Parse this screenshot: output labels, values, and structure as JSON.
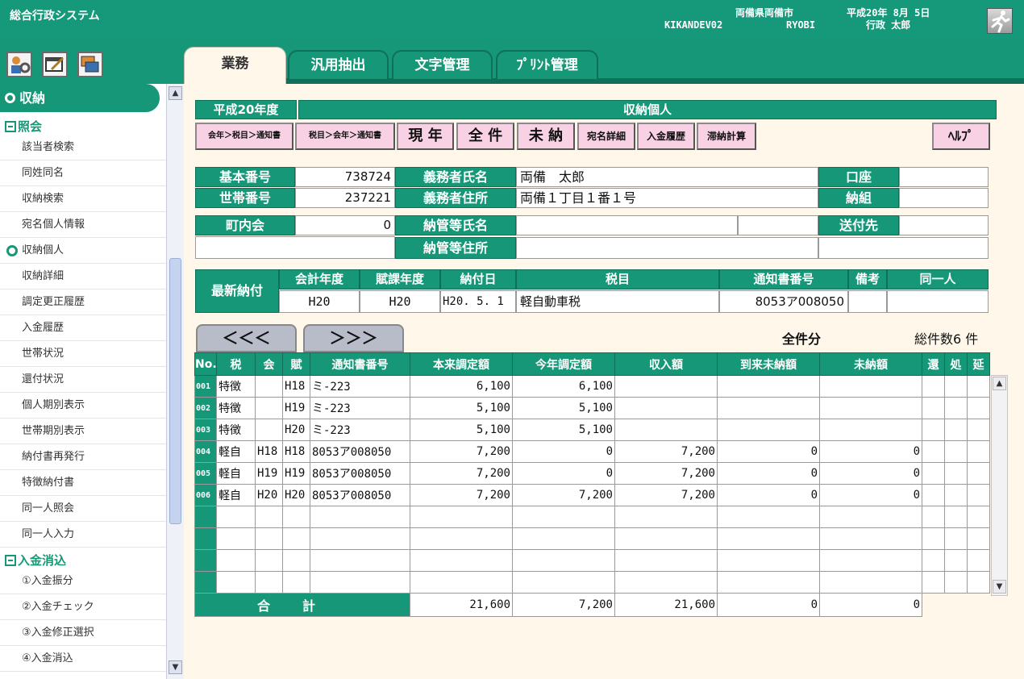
{
  "header": {
    "app_title": "総合行政システム",
    "line1": "両備県両備市  平成20年 8月 5日",
    "line2": "KIKANDEV02       RYOBI       行政 太郎",
    "org": "両備県両備市",
    "date": "平成20年 8月 5日",
    "terminal": "KIKANDEV02",
    "user_id": "RYOBI",
    "user_name": "行政 太郎"
  },
  "tabs": [
    {
      "label": "業務",
      "active": true
    },
    {
      "label": "汎用抽出",
      "active": false
    },
    {
      "label": "文字管理",
      "active": false
    },
    {
      "label": "ﾌﾟﾘﾝﾄ管理",
      "active": false
    }
  ],
  "sidebar": {
    "section": "収納",
    "groups": [
      {
        "label": "照会",
        "items": [
          "該当者検索",
          "同姓同名",
          "収納検索",
          "宛名個人情報",
          "収納個人",
          "収納詳細",
          "調定更正履歴",
          "入金履歴",
          "世帯状況",
          "還付状況",
          "個人期別表示",
          "世帯期別表示",
          "納付書再発行",
          "特徴納付書",
          "同一人照会",
          "同一人入力"
        ]
      },
      {
        "label": "入金消込",
        "items": [
          "①入金振分",
          "②入金チェック",
          "③入金修正選択",
          "④入金消込"
        ]
      }
    ],
    "selected": "収納個人"
  },
  "form": {
    "fiscal_year": "平成20年度",
    "title": "収納個人",
    "buttons": [
      "会年＞税目＞通知書",
      "税目＞会年＞通知書",
      "現 年",
      "全 件",
      "未 納",
      "宛名詳細",
      "入金履歴",
      "滞納計算"
    ],
    "help": "ﾍﾙﾌﾟ",
    "labels": {
      "kihon": "基本番号",
      "setai": "世帯番号",
      "chonai": "町内会",
      "gimusha_name": "義務者氏名",
      "gimusha_addr": "義務者住所",
      "nokan_name": "納管等氏名",
      "nokan_addr": "納管等住所",
      "koza": "口座",
      "nokumi": "納組",
      "sofusaki": "送付先"
    },
    "values": {
      "kihon": "738724",
      "setai": "237221",
      "chonai": "0",
      "gimusha_name": "両備　太郎",
      "gimusha_addr": "両備１丁目１番１号"
    }
  },
  "latest": {
    "label": "最新納付",
    "headers": [
      "会計年度",
      "賦課年度",
      "納付日",
      "税目",
      "通知書番号",
      "備考",
      "同一人"
    ],
    "values": [
      "H20",
      "H20",
      "H20. 5. 1",
      "軽自動車税",
      "8053ア008050",
      "",
      ""
    ]
  },
  "nav": {
    "prev": "＜＜＜",
    "next": "＞＞＞"
  },
  "summary": {
    "mode": "全件分",
    "count_label": "総件数6 件"
  },
  "grid": {
    "headers": [
      "No.",
      "税",
      "会",
      "賦",
      "通知書番号",
      "本来調定額",
      "今年調定額",
      "収入額",
      "到来未納額",
      "未納額",
      "還",
      "処",
      "延"
    ],
    "rows": [
      [
        "001",
        "特徴",
        "",
        "H18",
        "ミ-223",
        "6,100",
        "6,100",
        "",
        "",
        "",
        "",
        "",
        ""
      ],
      [
        "002",
        "特徴",
        "",
        "H19",
        "ミ-223",
        "5,100",
        "5,100",
        "",
        "",
        "",
        "",
        "",
        ""
      ],
      [
        "003",
        "特徴",
        "",
        "H20",
        "ミ-223",
        "5,100",
        "5,100",
        "",
        "",
        "",
        "",
        "",
        ""
      ],
      [
        "004",
        "軽自",
        "H18",
        "H18",
        "8053ア008050",
        "7,200",
        "0",
        "7,200",
        "0",
        "0",
        "",
        "",
        ""
      ],
      [
        "005",
        "軽自",
        "H19",
        "H19",
        "8053ア008050",
        "7,200",
        "0",
        "7,200",
        "0",
        "0",
        "",
        "",
        ""
      ],
      [
        "006",
        "軽自",
        "H20",
        "H20",
        "8053ア008050",
        "7,200",
        "7,200",
        "7,200",
        "0",
        "0",
        "",
        "",
        ""
      ],
      [
        "",
        "",
        "",
        "",
        "",
        "",
        "",
        "",
        "",
        "",
        "",
        "",
        ""
      ],
      [
        "",
        "",
        "",
        "",
        "",
        "",
        "",
        "",
        "",
        "",
        "",
        "",
        ""
      ],
      [
        "",
        "",
        "",
        "",
        "",
        "",
        "",
        "",
        "",
        "",
        "",
        "",
        ""
      ],
      [
        "",
        "",
        "",
        "",
        "",
        "",
        "",
        "",
        "",
        "",
        "",
        "",
        ""
      ]
    ],
    "total": {
      "label": "合計",
      "values": [
        "21,600",
        "7,200",
        "21,600",
        "0",
        "0"
      ]
    }
  }
}
